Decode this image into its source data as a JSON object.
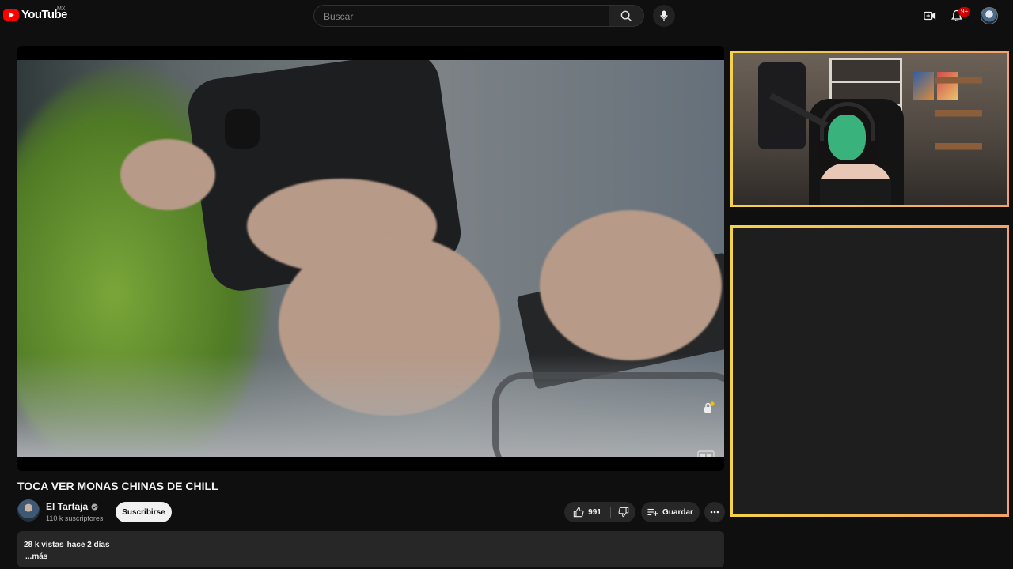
{
  "header": {
    "logo_text": "YouTube",
    "logo_country": "MX",
    "search_placeholder": "Buscar",
    "notification_count": "9+"
  },
  "video": {
    "title": "TOCA VER MONAS CHINAS DE CHILL"
  },
  "channel": {
    "name": "El Tartaja",
    "subscribers": "110 k suscriptores",
    "subscribe_label": "Suscribirse"
  },
  "actions": {
    "like_count": "991",
    "save_label": "Guardar"
  },
  "description": {
    "views": "28 k vistas",
    "date": "hace 2 días",
    "more_label": "...más"
  },
  "colors": {
    "brand_red": "#ff0000",
    "overlay_border_start": "#f6d24a",
    "overlay_border_end": "#f3a36a"
  }
}
